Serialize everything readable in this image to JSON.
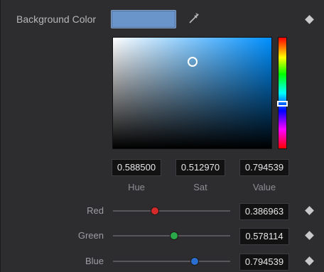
{
  "background": {
    "label": "Background Color",
    "swatch_color": "#6a95cb"
  },
  "icons": {
    "eyedropper": "eyedropper-icon",
    "keyframe": "keyframe-diamond-icon"
  },
  "hsv": {
    "hue": {
      "value": "0.588500",
      "caption": "Hue",
      "fraction": 0.5885
    },
    "sat": {
      "value": "0.512970",
      "caption": "Sat",
      "fraction": 0.51297
    },
    "value": {
      "value": "0.794539",
      "caption": "Value",
      "fraction": 0.794539
    }
  },
  "rgb": {
    "red": {
      "label": "Red",
      "value": "0.386963",
      "fraction": 0.386963,
      "knob_color": "#d42a2a"
    },
    "green": {
      "label": "Green",
      "value": "0.578114",
      "fraction": 0.578114,
      "knob_color": "#2aa84a"
    },
    "blue": {
      "label": "Blue",
      "value": "0.794539",
      "fraction": 0.794539,
      "knob_color": "#2a6fd0"
    }
  }
}
